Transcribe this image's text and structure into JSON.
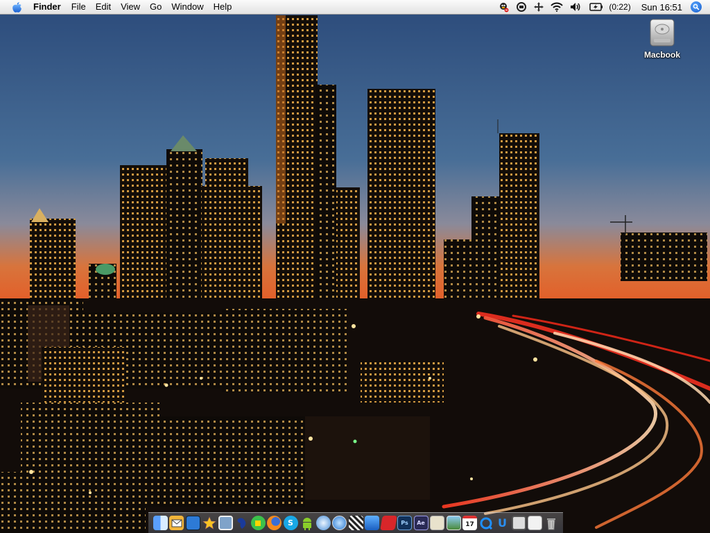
{
  "menubar": {
    "apple_icon": "apple-logo-icon",
    "app_name": "Finder",
    "menus": [
      "File",
      "Edit",
      "View",
      "Go",
      "Window",
      "Help"
    ],
    "status": {
      "battery_time": "(0:22)",
      "clock": "Sun 16:51"
    }
  },
  "desktop": {
    "drive_label": "Macbook"
  },
  "dock": {
    "icons": [
      "finder-icon",
      "mail-icon",
      "screen-icon",
      "star-icon",
      "photo-icon",
      "dictionary-icon",
      "green-app-icon",
      "firefox-icon",
      "skype-icon",
      "android-icon",
      "ichat-icon",
      "safari-icon",
      "clapper-icon",
      "keynote-icon",
      "red-app-icon",
      "photoshop-icon",
      "after-effects-icon",
      "preview-icon",
      "iphoto-icon",
      "ical-icon",
      "quicktime-icon",
      "u-app-icon",
      "monitor-icon",
      "screen-share-icon",
      "trash-icon"
    ],
    "labels": {
      "photoshop": "Ps",
      "after_effects": "Ae",
      "ical_day": "17",
      "u_app": "U"
    }
  },
  "colors": {
    "sky_top": "#2c4a78",
    "sky_horizon": "#e0602a",
    "city_lights": "#f6c15a",
    "traffic_trail": "#ff3322"
  }
}
